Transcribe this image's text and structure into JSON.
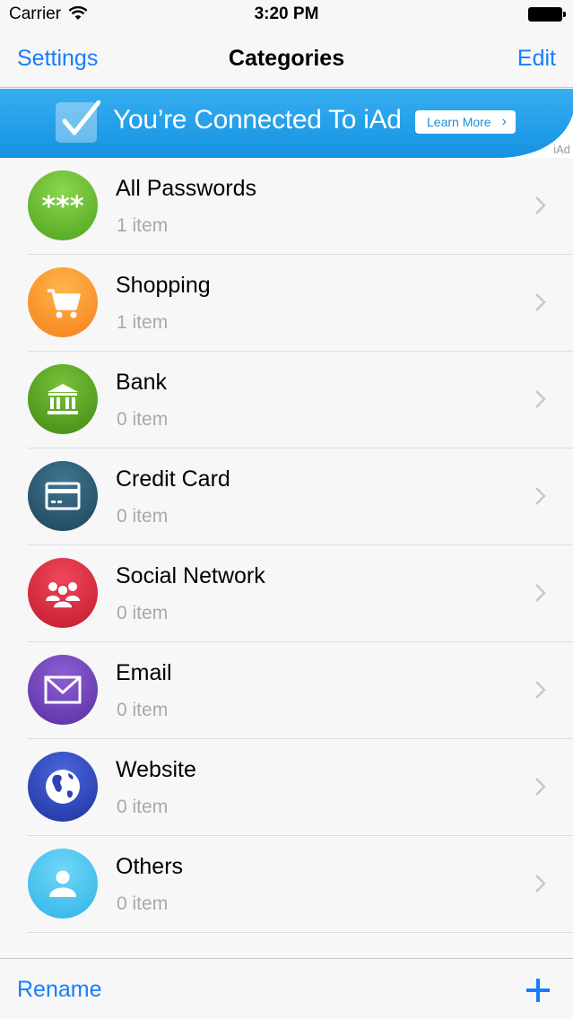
{
  "status_bar": {
    "carrier": "Carrier",
    "time": "3:20 PM"
  },
  "nav": {
    "left": "Settings",
    "title": "Categories",
    "right": "Edit"
  },
  "ad": {
    "text": "You’re Connected To iAd",
    "button": "Learn More",
    "tag": "iAd"
  },
  "categories": [
    {
      "name": "All Passwords",
      "count": "1 item",
      "icon": "asterisks-icon",
      "color": "#5cb52e"
    },
    {
      "name": "Shopping",
      "count": "1 item",
      "icon": "shopping-cart-icon",
      "color": "#f7901e"
    },
    {
      "name": "Bank",
      "count": "0 item",
      "icon": "bank-icon",
      "color": "#4e9a1a"
    },
    {
      "name": "Credit Card",
      "count": "0 item",
      "icon": "credit-card-icon",
      "color": "#25546a"
    },
    {
      "name": "Social Network",
      "count": "0 item",
      "icon": "people-icon",
      "color": "#d5283a"
    },
    {
      "name": "Email",
      "count": "0 item",
      "icon": "envelope-icon",
      "color": "#6a3cb0"
    },
    {
      "name": "Website",
      "count": "0 item",
      "icon": "globe-icon",
      "color": "#2c44b8"
    },
    {
      "name": "Others",
      "count": "0 item",
      "icon": "person-icon",
      "color": "#3ec3f0"
    }
  ],
  "toolbar": {
    "left": "Rename",
    "right_icon": "plus-icon"
  },
  "accent_color": "#147efb"
}
